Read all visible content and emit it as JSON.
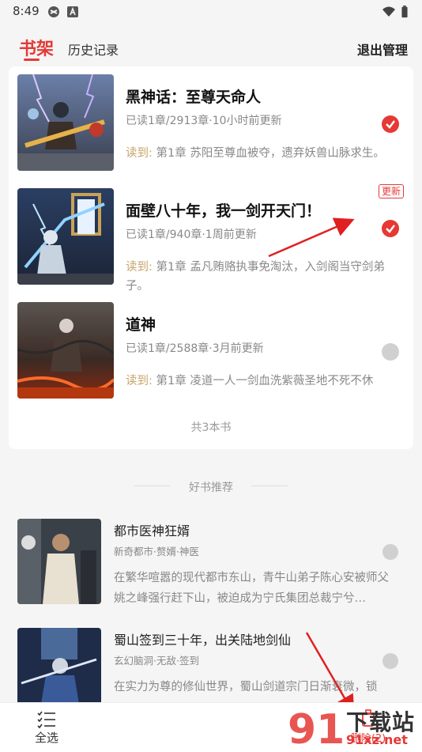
{
  "status_bar": {
    "time": "8:49"
  },
  "tabs": {
    "shelf": "书架",
    "history": "历史记录",
    "exit_manage": "退出管理"
  },
  "books": [
    {
      "title": "黑神话：至尊天命人",
      "meta": "已读1章/2913章·10小时前更新",
      "read_label": "读到:",
      "read_text": " 第1章 苏阳至尊血被夺，遗弃妖兽山脉求生。",
      "selected": true,
      "badge": ""
    },
    {
      "title": "面壁八十年，我一剑开天门！",
      "meta": "已读1章/940章·1周前更新",
      "read_label": "读到:",
      "read_text": " 第1章 孟凡贿赂执事免淘汰，入剑阁当守剑弟子。",
      "selected": true,
      "badge": "更新"
    },
    {
      "title": "道神",
      "meta": "已读1章/2588章·3月前更新",
      "read_label": "读到:",
      "read_text": " 第1章 凌道一人一剑血洗紫薇圣地不死不休",
      "selected": false,
      "badge": ""
    }
  ],
  "total": "共3本书",
  "recommend": {
    "title": "好书推荐",
    "items": [
      {
        "title": "都市医神狂婿",
        "meta": "新奇都市·赘婿·神医",
        "desc": "在繁华喧嚣的现代都市东山，青牛山弟子陈心安被师父姚之峰强行赶下山，被迫成为宁氏集团总裁宁兮…"
      },
      {
        "title": "蜀山签到三十年，出关陆地剑仙",
        "meta": "玄幻脑洞·无敌·签到",
        "desc": "在实力为尊的修仙世界，蜀山剑道宗门日渐衰微，锁"
      }
    ]
  },
  "bottom": {
    "select_all": "全选",
    "delete": "删除(2)"
  },
  "watermark": {
    "big": "下载站",
    "small": "91xz.net",
    "logo": "91"
  },
  "colors": {
    "accent": "#e53935",
    "read_label": "#c9a46a",
    "muted": "#888888"
  }
}
